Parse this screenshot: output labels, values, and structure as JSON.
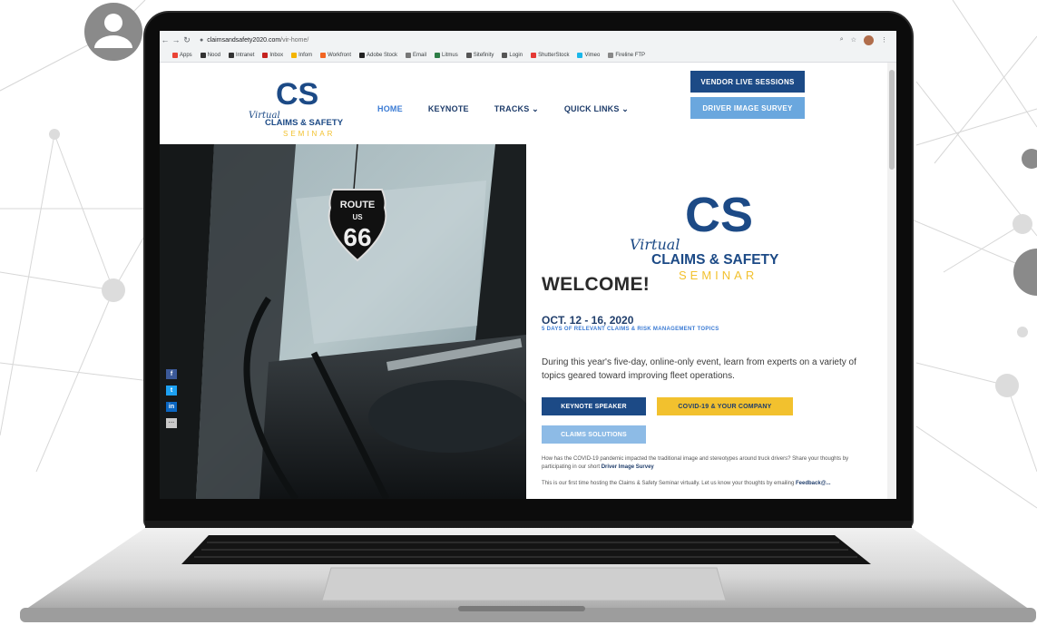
{
  "browser": {
    "url_domain": "claimsandsafety2020.com",
    "url_path": "/vir-home/",
    "bookmarks": [
      {
        "label": "Apps",
        "color": "#ea4335"
      },
      {
        "label": "Nood",
        "color": "#333333"
      },
      {
        "label": "Intranet",
        "color": "#333333"
      },
      {
        "label": "Inbox",
        "color": "#c5221f"
      },
      {
        "label": "Infom",
        "color": "#f4b400"
      },
      {
        "label": "Workfront",
        "color": "#f26522"
      },
      {
        "label": "Adobe Stock",
        "color": "#222222"
      },
      {
        "label": "Email",
        "color": "#777777"
      },
      {
        "label": "Litmus",
        "color": "#2d7d46"
      },
      {
        "label": "Sitefinity",
        "color": "#555555"
      },
      {
        "label": "Login",
        "color": "#555555"
      },
      {
        "label": "ShutterStock",
        "color": "#e53935"
      },
      {
        "label": "Vimeo",
        "color": "#1ab7ea"
      },
      {
        "label": "Fireline FTP",
        "color": "#888888"
      }
    ]
  },
  "header": {
    "logo_monogram": "CS",
    "logo_script": "Virtual",
    "logo_line1": "CLAIMS & SAFETY",
    "logo_line2": "SEMINAR",
    "menu": {
      "home": "HOME",
      "keynote": "KEYNOTE",
      "tracks": "TRACKS ⌄",
      "quick_links": "QUICK LINKS ⌄"
    },
    "vendor_button": "VENDOR LIVE SESSIONS",
    "driver_button": "DRIVER IMAGE SURVEY"
  },
  "hero": {
    "sign_line1": "ROUTE",
    "sign_line2": "US",
    "sign_line3": "66"
  },
  "content": {
    "welcome": "WELCOME!",
    "dates": "OCT. 12 - 16, 2020",
    "subtitle": "5 DAYS OF RELEVANT CLAIMS & RISK MANAGEMENT TOPICS",
    "paragraph": "During this year's five-day, online-only event, learn from experts on a variety of topics geared toward improving fleet operations.",
    "keynote_button": "KEYNOTE SPEAKER",
    "covid_button": "COVID-19 & YOUR COMPANY",
    "claims_button": "CLAIMS SOLUTIONS",
    "small1_text": "How has the COVID-19 pandemic impacted the traditional image and stereotypes around truck drivers? Share your thoughts by participating in our short",
    "small1_link": "Driver Image Survey",
    "small2_text": "This is our first time hosting the Claims & Safety Seminar virtually. Let us know your thoughts by emailing",
    "small2_link": "Feedback@..."
  },
  "colors": {
    "navy": "#1c4a86",
    "light_blue": "#6aa7de",
    "yellow": "#f2c12e",
    "accent_blue": "#3b7bd4"
  }
}
